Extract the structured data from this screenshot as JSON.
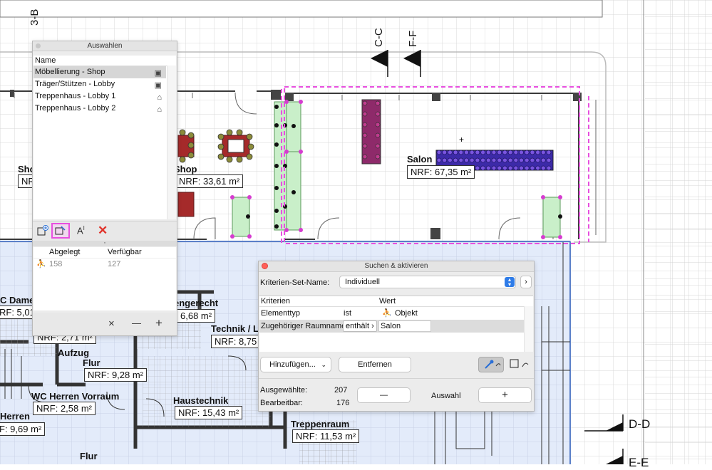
{
  "plan": {
    "section_markers": [
      "3-B",
      "C-C",
      "F-F",
      "D-D",
      "E-E"
    ],
    "room_names": {
      "shop_left": "Sho",
      "shop": "Shop",
      "salon": "Salon",
      "wc_damen": "C Damen",
      "engerecht": "engerecht",
      "technik": "Technik / L",
      "aufzug": "Aufzug",
      "flur_mid": "Flur",
      "wc_herren_vorraum": "WC Herren Vorraum",
      "haustechnik": "Haustechnik",
      "herren": "Herren",
      "treppenraum": "Treppenraum",
      "flur_bottom": "Flur"
    },
    "areas": {
      "shop_left": "NRF:",
      "shop": "NRF: 33,61 m²",
      "salon": "NRF: 67,35 m²",
      "wc_damen": "RF: 5,01",
      "engerecht": "6,68 m²",
      "technik": "NRF: 8,75",
      "aufzug": "NRF:    2,71 m²",
      "flur_mid": "NRF: 9,28 m²",
      "wc_herren_vorraum": "NRF:       2,58 m²",
      "haustechnik": "NRF: 15,43 m²",
      "herren": "F: 9,69 m²",
      "treppenraum": "NRF: 11,53 m²"
    },
    "colors": {
      "grid": "#d9d9d9",
      "selection": "#e84fe0",
      "blue_zone": "#e3ebfa",
      "wall": "#3a3a3a",
      "green_fill": "#c9efc9"
    }
  },
  "auswahlen": {
    "title": "Auswahlen",
    "column_name": "Name",
    "items": [
      {
        "label": "Möbellierung - Shop",
        "icon": "selection-set-icon"
      },
      {
        "label": "Träger/Stützen - Lobby",
        "icon": "selection-set-icon"
      },
      {
        "label": "Treppenhaus - Lobby 1",
        "icon": "house-icon"
      },
      {
        "label": "Treppenhaus - Lobby 2",
        "icon": "house-icon"
      }
    ],
    "toolbar_icons": [
      "add-selection-icon",
      "edit-selection-icon",
      "rename-icon",
      "delete-icon"
    ],
    "stats_headers": {
      "stored": "Abgelegt",
      "available": "Verfügbar"
    },
    "stats_values": {
      "stored": "158",
      "available": "127"
    },
    "footer_buttons": [
      "×",
      "—",
      "+"
    ]
  },
  "suchen": {
    "title": "Suchen & aktivieren",
    "set_name_label": "Kriterien-Set-Name:",
    "set_name_value": "Individuell",
    "col_criteria": "Kriterien",
    "col_value": "Wert",
    "rows": [
      {
        "criterion": "Elementtyp",
        "operator": "ist",
        "value": "Objekt"
      },
      {
        "criterion": "Zugehöriger Raumname",
        "operator": "enthält",
        "value": "Salon"
      }
    ],
    "add_button": "Hinzufügen...",
    "remove_button": "Entfernen",
    "selected_label": "Ausgewählte:",
    "selected_value": "207",
    "editable_label": "Bearbeitbar:",
    "editable_value": "176",
    "minus": "—",
    "selection_label": "Auswahl",
    "plus": "+"
  }
}
